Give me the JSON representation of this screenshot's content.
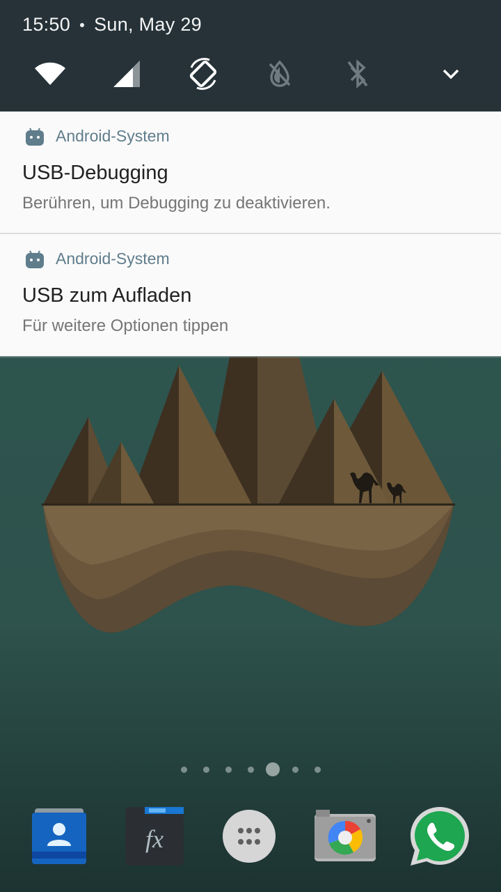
{
  "status": {
    "time": "15:50",
    "date": "Sun, May 29"
  },
  "quick_settings": [
    {
      "icon": "wifi-icon",
      "state": "on"
    },
    {
      "icon": "cellular-signal-icon",
      "state": "on"
    },
    {
      "icon": "auto-rotate-icon",
      "state": "on"
    },
    {
      "icon": "invert-colors-off-icon",
      "state": "off"
    },
    {
      "icon": "bluetooth-off-icon",
      "state": "off"
    },
    {
      "icon": "expand-chevron-icon",
      "state": "on"
    }
  ],
  "notifications": [
    {
      "app": "Android-System",
      "title": "USB-Debugging",
      "text": "Berühren, um Debugging zu deaktivieren."
    },
    {
      "app": "Android-System",
      "title": "USB zum Aufladen",
      "text": "Für weitere Optionen tippen"
    }
  ],
  "home": {
    "page_count": 7,
    "current_page": 5
  },
  "dock": [
    {
      "icon": "contacts-icon"
    },
    {
      "icon": "fx-file-explorer-icon"
    },
    {
      "icon": "app-drawer-icon"
    },
    {
      "icon": "camera-icon"
    },
    {
      "icon": "whatsapp-icon"
    }
  ],
  "colors": {
    "header_bg": "#263238",
    "notification_bg": "#fafafa",
    "app_name": "#607d8b",
    "wallpaper": "#2f5752"
  }
}
